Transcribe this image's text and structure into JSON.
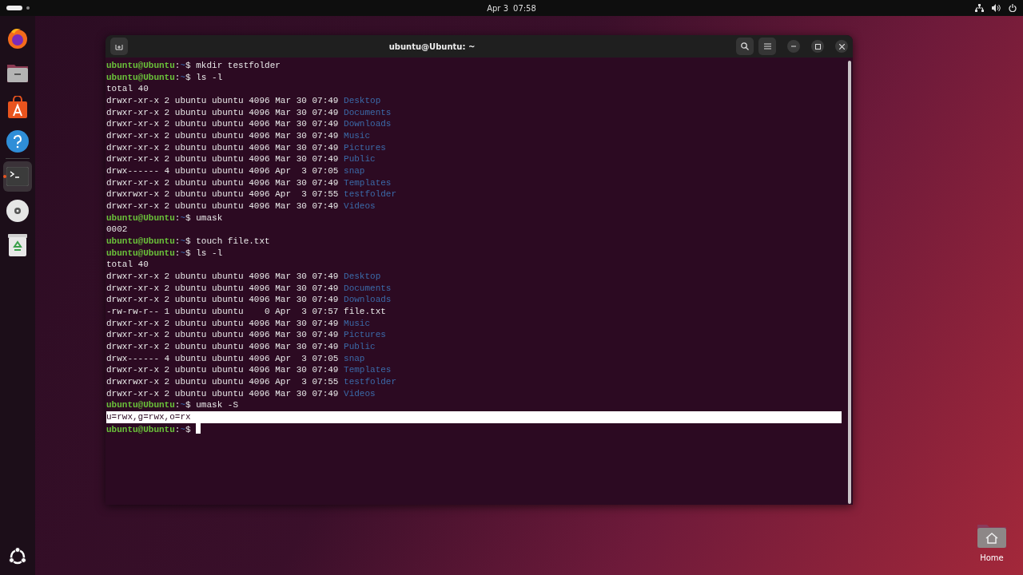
{
  "top_bar": {
    "date": "Apr 3",
    "time": "07:58"
  },
  "dock": {
    "items": [
      {
        "kind": "browser",
        "running": false
      },
      {
        "kind": "files",
        "running": false
      },
      {
        "kind": "store",
        "running": false
      },
      {
        "kind": "help",
        "running": false
      },
      {
        "kind": "terminal",
        "running": true
      },
      {
        "kind": "disc",
        "running": false
      },
      {
        "kind": "trash",
        "running": false
      }
    ]
  },
  "terminal": {
    "title": "ubuntu@Ubuntu: ~",
    "lines": [
      {
        "kind": "prompt",
        "user": "ubuntu@Ubuntu",
        "sep": ":",
        "path": "~",
        "sign": "$",
        "command": "mkdir testfolder",
        "cursor": false
      },
      {
        "kind": "prompt",
        "user": "ubuntu@Ubuntu",
        "sep": ":",
        "path": "~",
        "sign": "$",
        "command": "ls -l",
        "cursor": false
      },
      {
        "kind": "output",
        "text": "total 40",
        "selected": false
      },
      {
        "kind": "listing",
        "meta": "drwxr-xr-x 2 ubuntu ubuntu 4096 Mar 30 07:49",
        "name": "Desktop",
        "directory": true
      },
      {
        "kind": "listing",
        "meta": "drwxr-xr-x 2 ubuntu ubuntu 4096 Mar 30 07:49",
        "name": "Documents",
        "directory": true
      },
      {
        "kind": "listing",
        "meta": "drwxr-xr-x 2 ubuntu ubuntu 4096 Mar 30 07:49",
        "name": "Downloads",
        "directory": true
      },
      {
        "kind": "listing",
        "meta": "drwxr-xr-x 2 ubuntu ubuntu 4096 Mar 30 07:49",
        "name": "Music",
        "directory": true
      },
      {
        "kind": "listing",
        "meta": "drwxr-xr-x 2 ubuntu ubuntu 4096 Mar 30 07:49",
        "name": "Pictures",
        "directory": true
      },
      {
        "kind": "listing",
        "meta": "drwxr-xr-x 2 ubuntu ubuntu 4096 Mar 30 07:49",
        "name": "Public",
        "directory": true
      },
      {
        "kind": "listing",
        "meta": "drwx------ 4 ubuntu ubuntu 4096 Apr  3 07:05",
        "name": "snap",
        "directory": true
      },
      {
        "kind": "listing",
        "meta": "drwxr-xr-x 2 ubuntu ubuntu 4096 Mar 30 07:49",
        "name": "Templates",
        "directory": true
      },
      {
        "kind": "listing",
        "meta": "drwxrwxr-x 2 ubuntu ubuntu 4096 Apr  3 07:55",
        "name": "testfolder",
        "directory": true
      },
      {
        "kind": "listing",
        "meta": "drwxr-xr-x 2 ubuntu ubuntu 4096 Mar 30 07:49",
        "name": "Videos",
        "directory": true
      },
      {
        "kind": "prompt",
        "user": "ubuntu@Ubuntu",
        "sep": ":",
        "path": "~",
        "sign": "$",
        "command": "umask",
        "cursor": false
      },
      {
        "kind": "output",
        "text": "0002",
        "selected": false
      },
      {
        "kind": "prompt",
        "user": "ubuntu@Ubuntu",
        "sep": ":",
        "path": "~",
        "sign": "$",
        "command": "touch file.txt",
        "cursor": false
      },
      {
        "kind": "prompt",
        "user": "ubuntu@Ubuntu",
        "sep": ":",
        "path": "~",
        "sign": "$",
        "command": "ls -l",
        "cursor": false
      },
      {
        "kind": "output",
        "text": "total 40",
        "selected": false
      },
      {
        "kind": "listing",
        "meta": "drwxr-xr-x 2 ubuntu ubuntu 4096 Mar 30 07:49",
        "name": "Desktop",
        "directory": true
      },
      {
        "kind": "listing",
        "meta": "drwxr-xr-x 2 ubuntu ubuntu 4096 Mar 30 07:49",
        "name": "Documents",
        "directory": true
      },
      {
        "kind": "listing",
        "meta": "drwxr-xr-x 2 ubuntu ubuntu 4096 Mar 30 07:49",
        "name": "Downloads",
        "directory": true
      },
      {
        "kind": "listing",
        "meta": "-rw-rw-r-- 1 ubuntu ubuntu    0 Apr  3 07:57",
        "name": "file.txt",
        "directory": false
      },
      {
        "kind": "listing",
        "meta": "drwxr-xr-x 2 ubuntu ubuntu 4096 Mar 30 07:49",
        "name": "Music",
        "directory": true
      },
      {
        "kind": "listing",
        "meta": "drwxr-xr-x 2 ubuntu ubuntu 4096 Mar 30 07:49",
        "name": "Pictures",
        "directory": true
      },
      {
        "kind": "listing",
        "meta": "drwxr-xr-x 2 ubuntu ubuntu 4096 Mar 30 07:49",
        "name": "Public",
        "directory": true
      },
      {
        "kind": "listing",
        "meta": "drwx------ 4 ubuntu ubuntu 4096 Apr  3 07:05",
        "name": "snap",
        "directory": true
      },
      {
        "kind": "listing",
        "meta": "drwxr-xr-x 2 ubuntu ubuntu 4096 Mar 30 07:49",
        "name": "Templates",
        "directory": true
      },
      {
        "kind": "listing",
        "meta": "drwxrwxr-x 2 ubuntu ubuntu 4096 Apr  3 07:55",
        "name": "testfolder",
        "directory": true
      },
      {
        "kind": "listing",
        "meta": "drwxr-xr-x 2 ubuntu ubuntu 4096 Mar 30 07:49",
        "name": "Videos",
        "directory": true
      },
      {
        "kind": "prompt",
        "user": "ubuntu@Ubuntu",
        "sep": ":",
        "path": "~",
        "sign": "$",
        "command": "umask -S",
        "cursor": false
      },
      {
        "kind": "output",
        "text": "u=rwx,g=rwx,o=rx",
        "selected": true
      },
      {
        "kind": "prompt",
        "user": "ubuntu@Ubuntu",
        "sep": ":",
        "path": "~",
        "sign": "$",
        "cursor": true
      }
    ]
  },
  "desktop_icons": [
    {
      "label": "Home"
    }
  ]
}
